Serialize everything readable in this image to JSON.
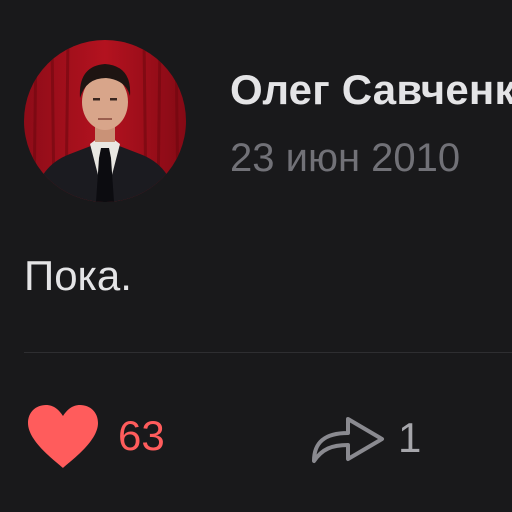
{
  "post": {
    "author_name": "Олег Савченко",
    "date": "23 июн 2010",
    "text": "Пока."
  },
  "actions": {
    "like_icon": "heart-icon",
    "like_count": "63",
    "like_color": "#ff5c5c",
    "share_icon": "share-arrow-icon",
    "share_count": "1"
  },
  "colors": {
    "background": "#19191b",
    "primary_text": "#e4e4e6",
    "secondary_text": "#717177",
    "divider": "#2e2e31"
  }
}
